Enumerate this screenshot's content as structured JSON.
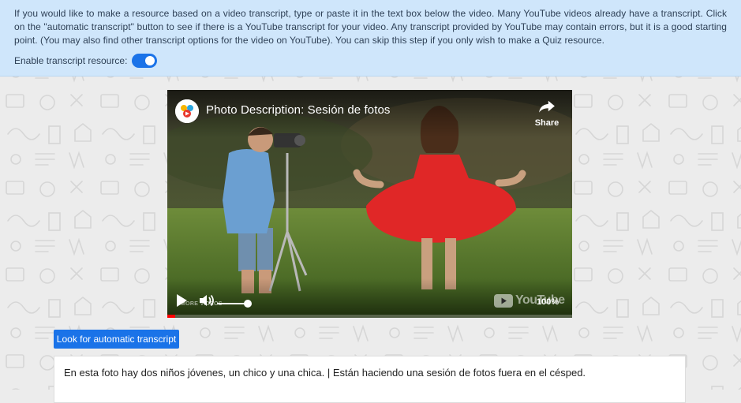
{
  "info_panel": {
    "description": "If you would like to make a resource based on a video transcript, type or paste it in the text box below the video. Many YouTube videos already have a transcript. Click on the \"automatic transcript\" button to see if there is a YouTube transcript for your video. Any transcript provided by YouTube may contain errors, but it is a good starting point. (You may also find other transcript options for the video on YouTube). You can skip this step if you only wish to make a Quiz resource.",
    "toggle_label": "Enable transcript resource:",
    "toggle_on": true
  },
  "video": {
    "title": "Photo Description: Sesión de fotos",
    "share_label": "Share",
    "more_videos_label": "MORE VIDEOS",
    "youtube_label": "YouTube",
    "zoom_label": "100%",
    "progress": 0.02
  },
  "actions": {
    "look_button": "Look for automatic transcript"
  },
  "transcript": {
    "value": "En esta foto hay dos niños jóvenes, un chico y una chica. | Están haciendo una sesión de fotos fuera en el césped."
  },
  "colors": {
    "accent": "#1a73e8",
    "panel_bg": "#cfe6fb",
    "progress_red": "#ff0000"
  },
  "icons": [
    "play-icon",
    "volume-icon",
    "share-icon",
    "youtube-logo-icon",
    "channel-logo-icon"
  ]
}
